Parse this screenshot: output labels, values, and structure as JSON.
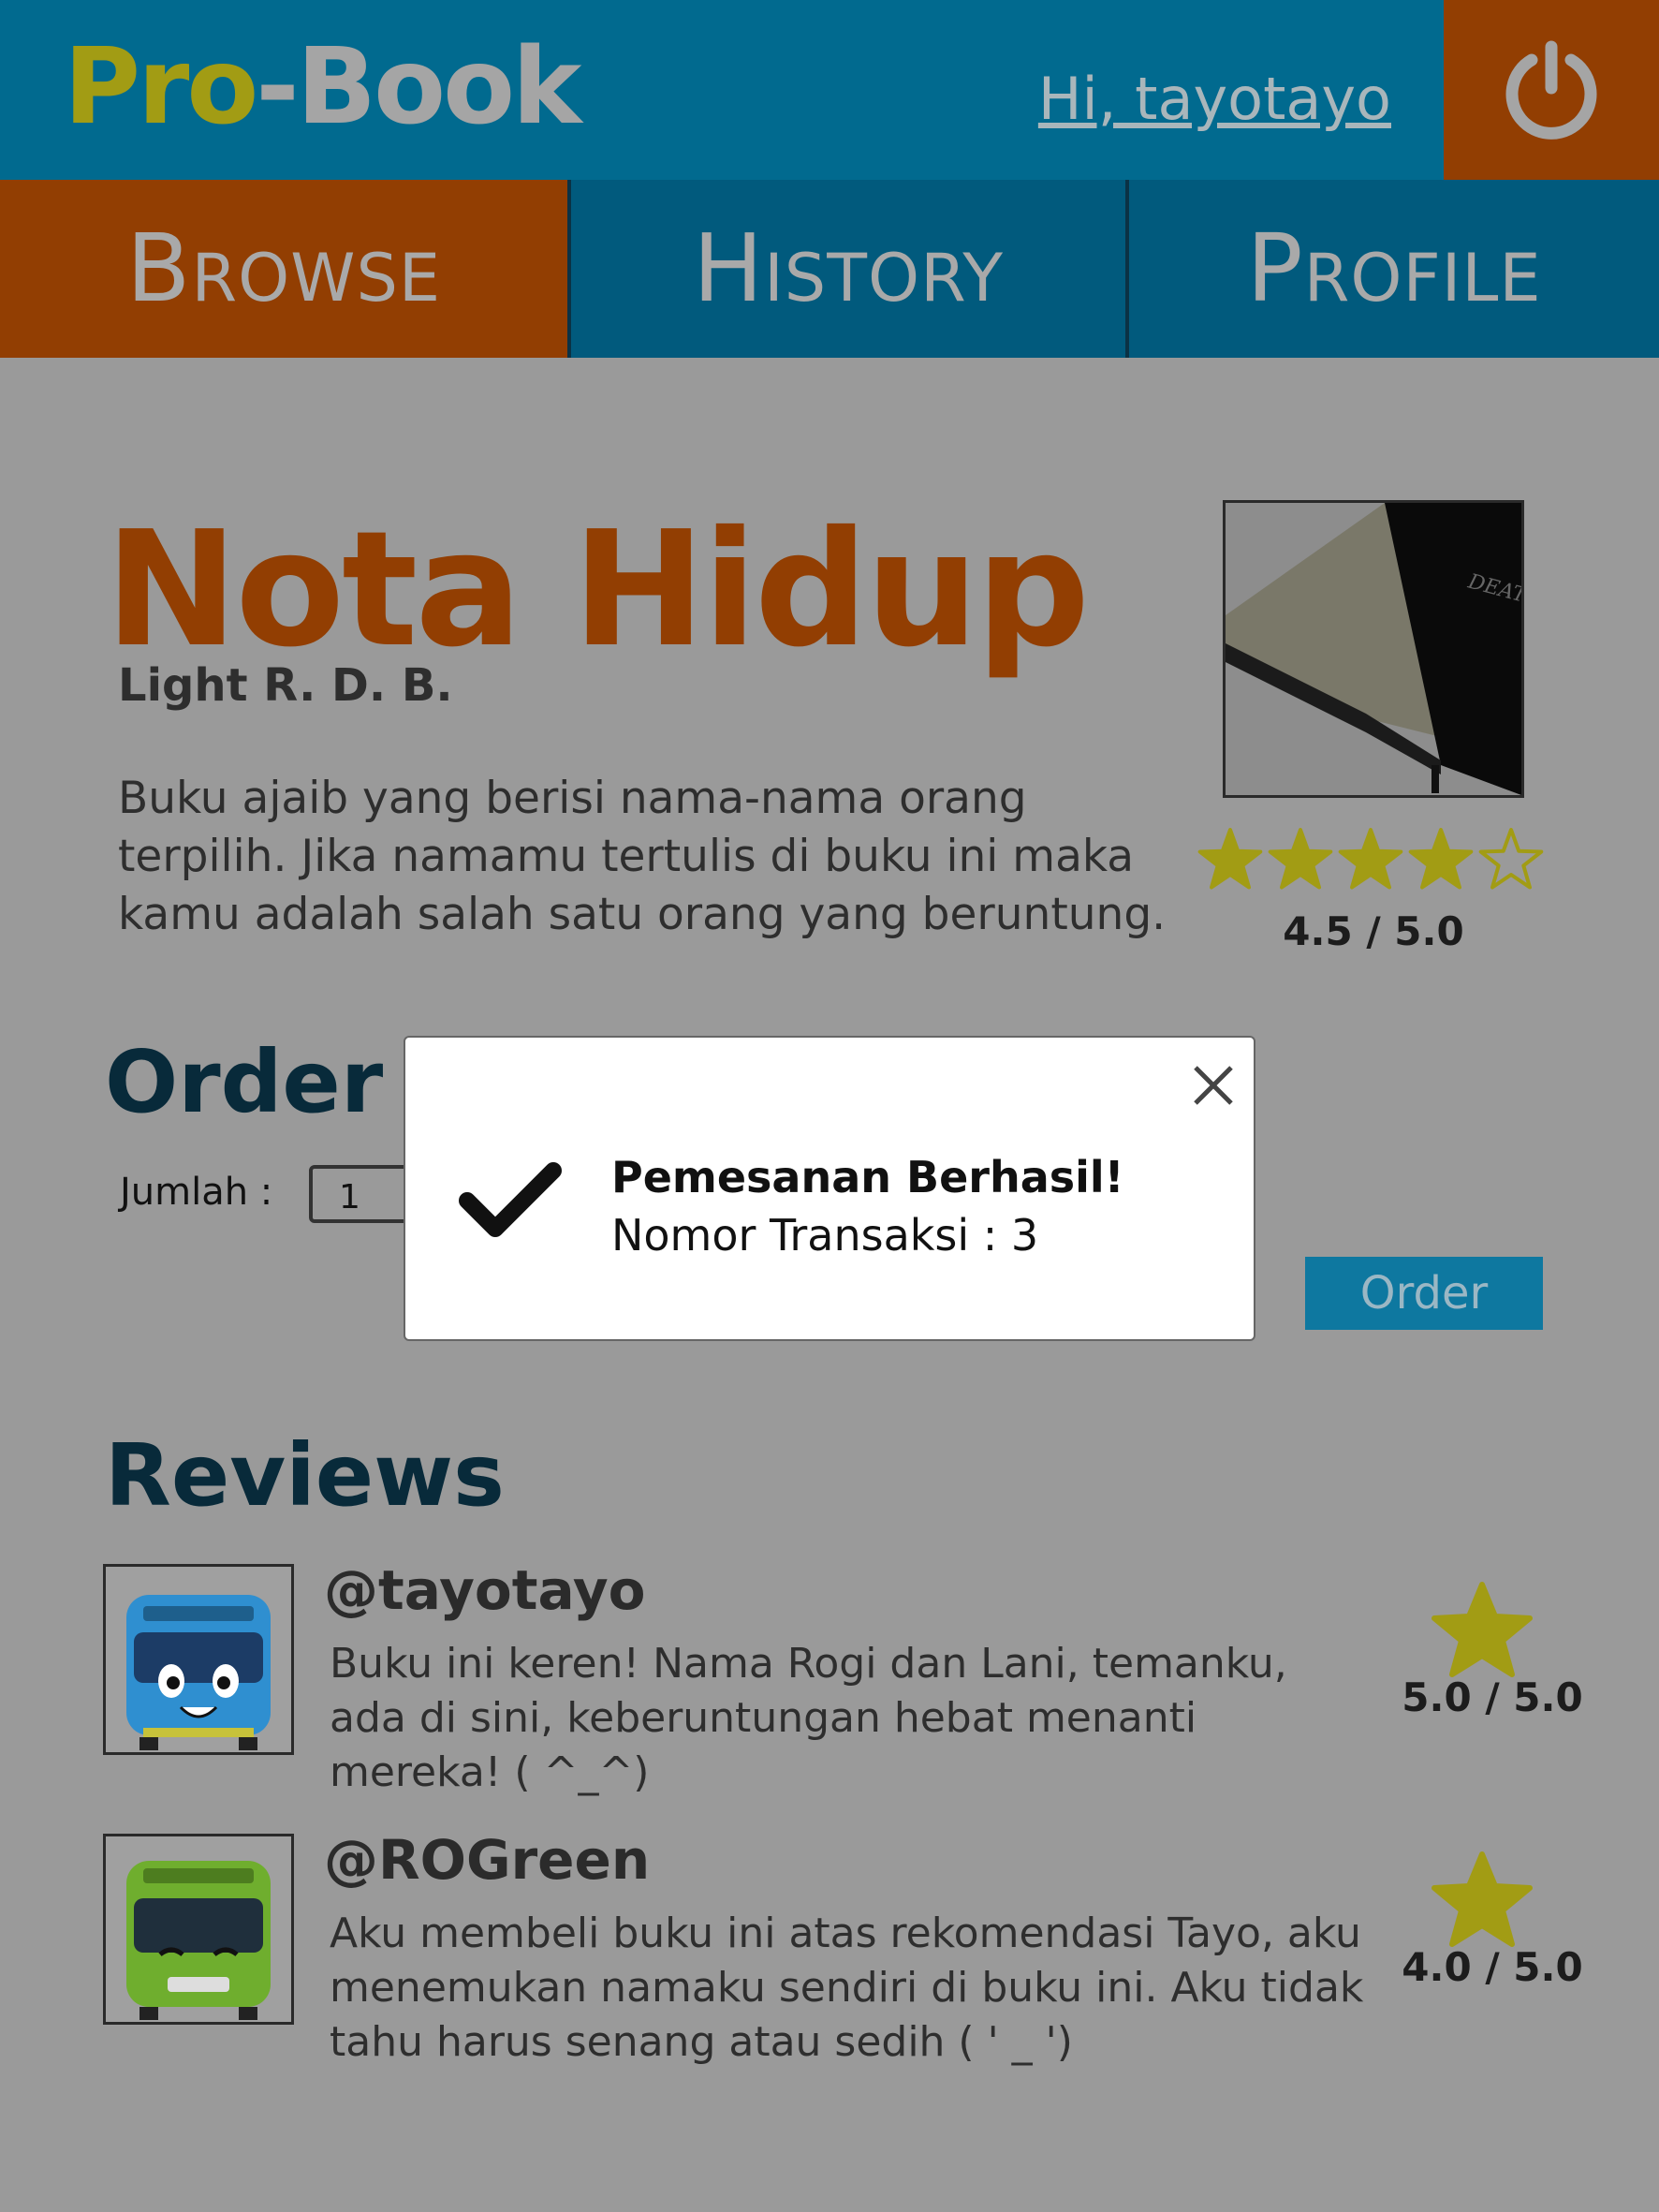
{
  "header": {
    "logo_pro": "Pro",
    "logo_dash": "-",
    "logo_book": "Book",
    "greeting": "Hi, tayotayo",
    "logout_icon": "power-icon"
  },
  "nav": {
    "tabs": [
      {
        "label": "Browse",
        "active": true
      },
      {
        "label": "History",
        "active": false
      },
      {
        "label": "Profile",
        "active": false
      }
    ]
  },
  "book": {
    "title": "Nota Hidup",
    "author": "Light R. D. B.",
    "description": "Buku ajaib yang berisi nama-nama orang terpilih. Jika namamu tertulis di buku ini maka kamu adalah salah satu orang yang beruntung.",
    "rating_text": "4.5 / 5.0",
    "rating_value": 4.5,
    "stars_filled": 4,
    "stars_total": 5
  },
  "order": {
    "heading": "Order",
    "quantity_label": "Jumlah :",
    "quantity_value": "1",
    "button_label": "Order"
  },
  "reviews": {
    "heading": "Reviews",
    "items": [
      {
        "username": "@tayotayo",
        "text": "Buku ini keren! Nama Rogi dan Lani, temanku, ada di sini, keberuntungan hebat menanti mereka! (  ^_^)",
        "score_text": "5.0 / 5.0",
        "score": 5.0
      },
      {
        "username": "@ROGreen",
        "text": "Aku membeli buku ini atas rekomendasi Tayo, aku menemukan namaku sendiri di buku ini. Aku tidak tahu harus senang atau sedih (   ' _ ')",
        "score_text": "4.0 / 5.0",
        "score": 4.0
      }
    ]
  },
  "modal": {
    "title": "Pemesanan Berhasil!",
    "body": "Nomor Transaksi : 3",
    "close_icon": "close-icon",
    "status_icon": "checkmark-icon"
  },
  "colors": {
    "header_bg": "#016a8f",
    "accent_orange": "#923e02",
    "star_yellow": "#a29c14",
    "overlay_bg": "#9a9a9a"
  }
}
